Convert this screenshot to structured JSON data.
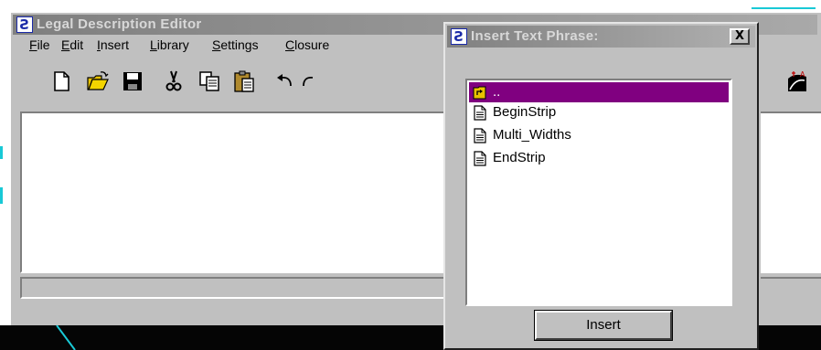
{
  "main_window": {
    "title": "Legal Description Editor",
    "menu": [
      {
        "mnemonic": "F",
        "rest": "ile"
      },
      {
        "mnemonic": "E",
        "rest": "dit"
      },
      {
        "mnemonic": "I",
        "rest": "nsert"
      },
      {
        "mnemonic": "L",
        "rest": "ibrary"
      },
      {
        "mnemonic": "S",
        "rest": "ettings"
      },
      {
        "mnemonic": "C",
        "rest": "losure"
      }
    ],
    "toolbar_icons": [
      "new-file-icon",
      "open-folder-icon",
      "save-icon",
      "cut-icon",
      "copy-icon",
      "paste-icon",
      "undo-icon",
      "redo-icon",
      "annotate-icon"
    ]
  },
  "dialog": {
    "title": "Insert Text Phrase:",
    "close_label": "X",
    "items": [
      {
        "label": "..",
        "icon": "parent-folder-icon",
        "selected": true
      },
      {
        "label": "BeginStrip",
        "icon": "document-icon",
        "selected": false
      },
      {
        "label": "Multi_Widths",
        "icon": "document-icon",
        "selected": false
      },
      {
        "label": "EndStrip",
        "icon": "document-icon",
        "selected": false
      }
    ],
    "insert_label": "Insert"
  },
  "colors": {
    "selection": "#800080",
    "window_face": "#c0c0c0",
    "app_icon_blue": "#1a2aa8",
    "desktop_line_cyan": "#19c9d6"
  }
}
